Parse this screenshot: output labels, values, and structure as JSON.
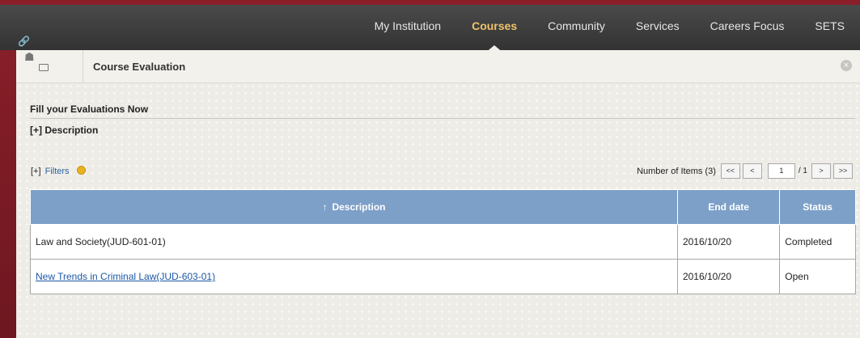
{
  "nav": {
    "items": [
      {
        "label": "My Institution",
        "active": false
      },
      {
        "label": "Courses",
        "active": true
      },
      {
        "label": "Community",
        "active": false
      },
      {
        "label": "Services",
        "active": false
      },
      {
        "label": "Careers Focus",
        "active": false
      },
      {
        "label": "SETS",
        "active": false
      }
    ],
    "link_icon": "🔗"
  },
  "breadcrumb": {
    "title": "Course Evaluation"
  },
  "section": {
    "title": "Fill your Evaluations Now",
    "description_toggle": "[+] Description"
  },
  "filters": {
    "prefix": "[+]",
    "label": "Filters"
  },
  "pager": {
    "count_text": "Number of Items (3)",
    "first": "<<",
    "prev": "<",
    "page": "1",
    "of": "/ 1",
    "next": ">",
    "last": ">>"
  },
  "table": {
    "headers": {
      "description": "Description",
      "end_date": "End date",
      "status": "Status"
    },
    "sort_arrow": "↑",
    "rows": [
      {
        "description": "Law and Society(JUD-601-01)",
        "end_date": "2016/10/20",
        "status": "Completed",
        "link": false
      },
      {
        "description": "New Trends in Criminal Law(JUD-603-01)",
        "end_date": "2016/10/20",
        "status": "Open",
        "link": true
      }
    ]
  },
  "colors": {
    "top_accent": "#8a1f29",
    "nav_active": "#f0c36a",
    "table_header": "#7da0c8",
    "link": "#1c57a6"
  }
}
